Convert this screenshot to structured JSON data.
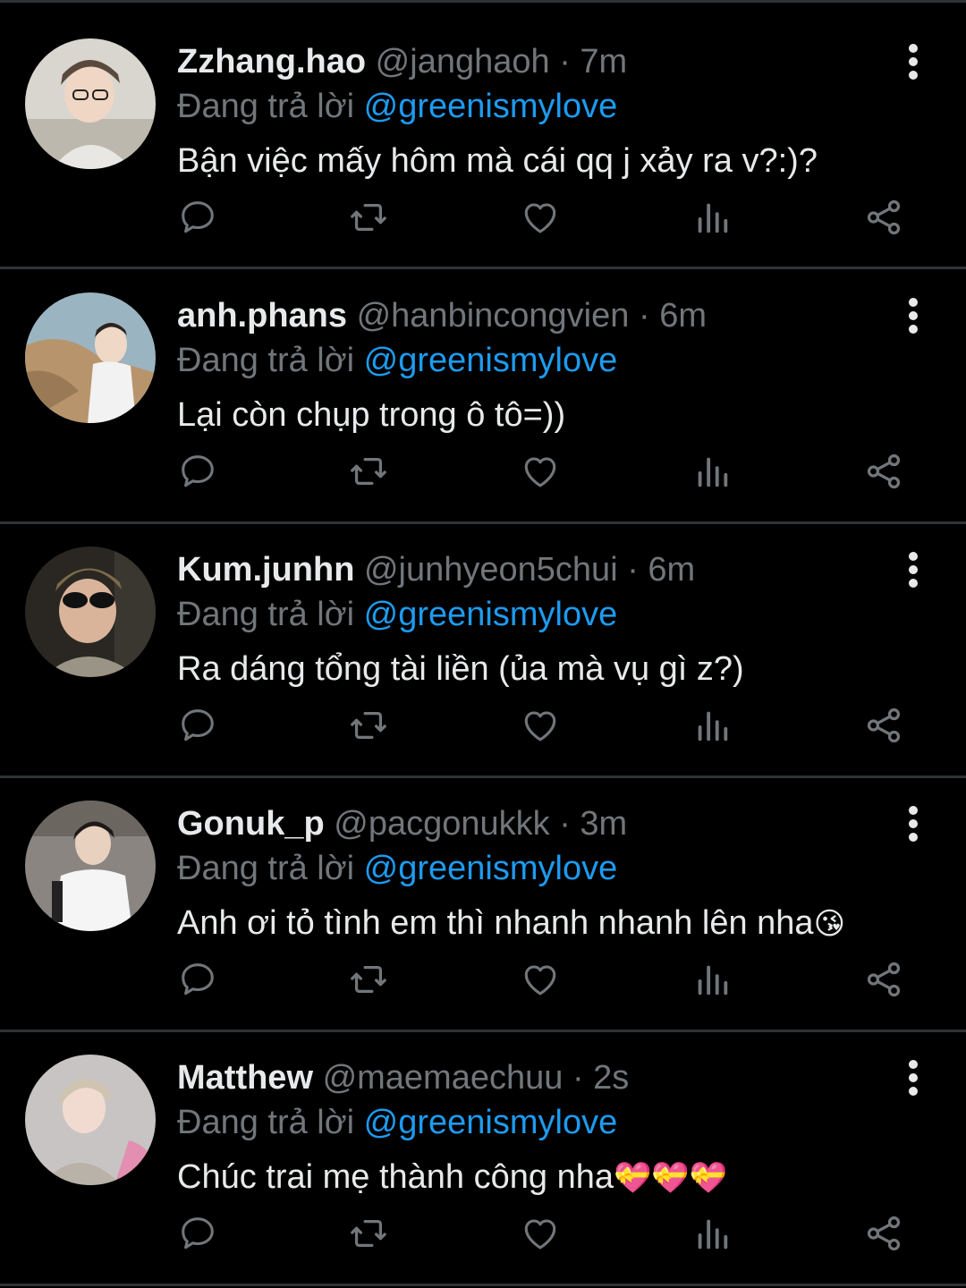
{
  "theme": {
    "background": "#000000",
    "text": "#e7e9ea",
    "muted": "#71767b",
    "link": "#1d9bf0",
    "divider": "#2f3336"
  },
  "replying_label": "Đang trả lời",
  "separator": "·",
  "icons": {
    "reply": "reply-icon",
    "retweet": "retweet-icon",
    "like": "heart-icon",
    "views": "views-icon",
    "share": "share-icon",
    "more": "more-vertical-icon"
  },
  "tweets": [
    {
      "name": "Zzhang.hao",
      "handle": "@janghaoh",
      "time": "7m",
      "reply_to": "@greenismylove",
      "text": "Bận việc mấy hôm mà cái qq j xảy ra v?:)?",
      "emoji": ""
    },
    {
      "name": "anh.phans",
      "handle": "@hanbincongvien",
      "time": "6m",
      "reply_to": "@greenismylove",
      "text": "Lại còn chụp trong ô tô=))",
      "emoji": ""
    },
    {
      "name": "Kum.junhn",
      "handle": "@junhyeon5chui",
      "time": "6m",
      "reply_to": "@greenismylove",
      "text": "Ra dáng tổng tài liền (ủa mà vụ gì z?)",
      "emoji": ""
    },
    {
      "name": "Gonuk_p",
      "handle": "@pacgonukkk",
      "time": "3m",
      "reply_to": "@greenismylove",
      "text": "Anh ơi tỏ tình em thì nhanh nhanh lên nha",
      "emoji": "😘"
    },
    {
      "name": "Matthew",
      "handle": "@maemaechuu",
      "time": "2s",
      "reply_to": "@greenismylove",
      "text": "Chúc trai mẹ thành công nha",
      "emoji": "💝💝💝"
    }
  ]
}
